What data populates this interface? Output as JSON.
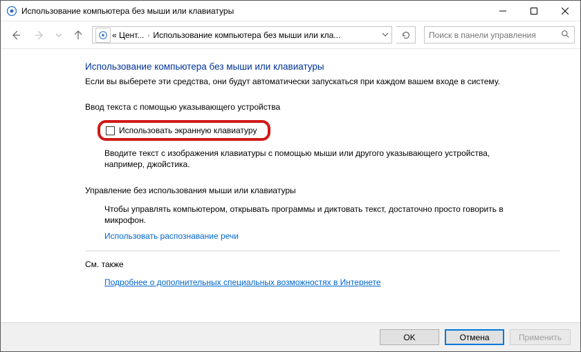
{
  "window": {
    "title": "Использование компьютера без мыши или клавиатуры"
  },
  "toolbar": {
    "breadcrumb_prefix": "« Цент...",
    "breadcrumb_current": "Использование компьютера без мыши или кла...",
    "search_placeholder": "Поиск в панели управления"
  },
  "page": {
    "title": "Использование компьютера без мыши или клавиатуры",
    "description": "Если вы выберете эти средства, они будут автоматически запускаться при каждом вашем входе в систему."
  },
  "section1": {
    "heading": "Ввод текста с помощью указывающего устройства",
    "checkbox_label": "Использовать экранную клавиатуру",
    "body": "Вводите текст с изображения клавиатуры с помощью мыши или другого указывающего устройства, например, джойстика."
  },
  "section2": {
    "heading": "Управление без использования мыши или клавиатуры",
    "body": "Чтобы управлять компьютером, открывать программы и диктовать текст, достаточно просто говорить в микрофон.",
    "link": "Использовать распознавание речи"
  },
  "section3": {
    "heading": "См. также",
    "link": "Подробнее о дополнительных специальных возможностях в Интернете"
  },
  "buttons": {
    "ok": "OK",
    "cancel": "Отмена",
    "apply": "Применить"
  }
}
